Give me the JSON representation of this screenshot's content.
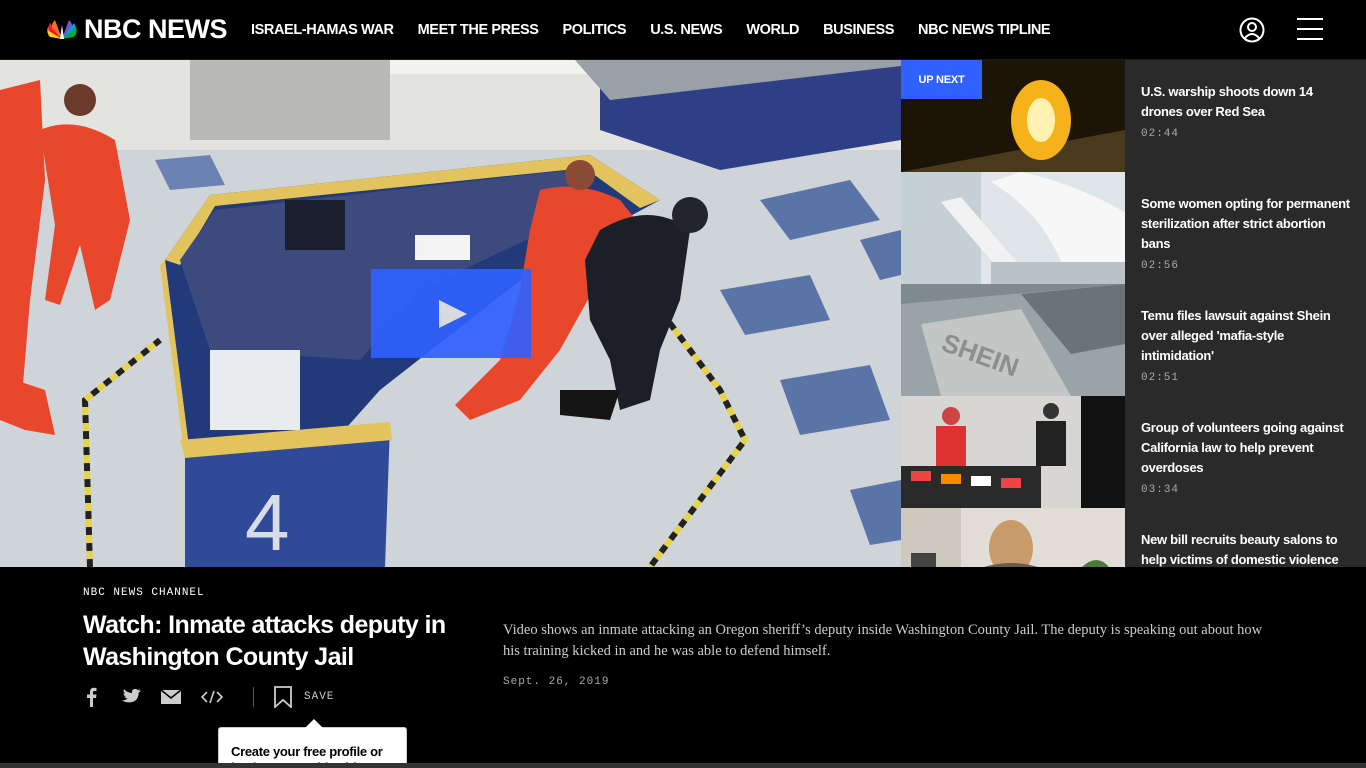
{
  "header": {
    "logo_text": "NBC NEWS",
    "nav": [
      "ISRAEL-HAMAS WAR",
      "MEET THE PRESS",
      "POLITICS",
      "U.S. NEWS",
      "WORLD",
      "BUSINESS",
      "NBC NEWS TIPLINE"
    ],
    "icons": [
      "account-icon",
      "hamburger-menu-icon"
    ]
  },
  "video": {
    "overlay_label": "4",
    "play_icon": "play-icon"
  },
  "playlist": {
    "up_next_label": "UP NEXT",
    "items": [
      {
        "title": "U.S. warship shoots down 14 drones over Red Sea",
        "duration": "02:44"
      },
      {
        "title": "Some women opting for permanent sterilization after strict abortion bans",
        "duration": "02:56"
      },
      {
        "title": "Temu files lawsuit against Shein over alleged 'mafia-style intimidation'",
        "duration": "02:51"
      },
      {
        "title": "Group of volunteers going against California law to help prevent overdoses",
        "duration": "03:34"
      },
      {
        "title": "New bill recruits beauty salons to help victims of domestic violence",
        "duration": ""
      }
    ]
  },
  "info": {
    "channel": "NBC NEWS CHANNEL",
    "title": "Watch: Inmate attacks deputy in Washington County Jail",
    "description": "Video shows an inmate attacking an Oregon sheriff’s deputy inside Washington County Jail. The deputy is speaking out about how his training kicked in and he was able to defend himself.",
    "date": "Sept. 26, 2019",
    "save_label": "SAVE",
    "tooltip": "Create your free profile or log in to save this video"
  },
  "colors": {
    "accent": "#3061ff",
    "background": "#000000",
    "playlist_bg": "#2a2a2a"
  }
}
